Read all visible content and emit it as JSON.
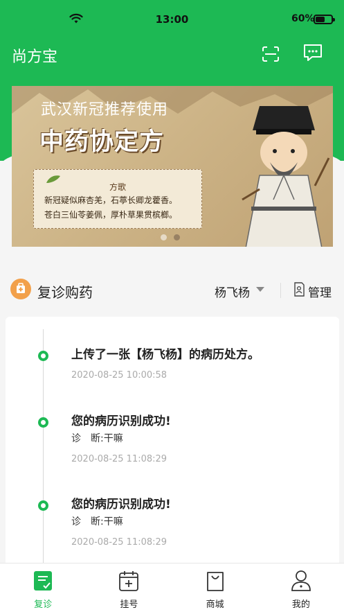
{
  "status_bar": {
    "time": "13:00",
    "battery_percent": "60%",
    "battery_level": 0.6
  },
  "header": {
    "app_title": "尚方宝",
    "icons": [
      "scan-icon",
      "message-icon"
    ]
  },
  "banner": {
    "line1": "武汉新冠推荐使用",
    "line2": "中药协定方",
    "poem_title": "方歌",
    "poem_line1": "新冠疑似麻杏羌，石葶长卿龙藿香。",
    "poem_line2": "苍白三仙苓姜佩，厚朴草果贯槟榔。",
    "slide_count": 2,
    "active_slide": 2
  },
  "section": {
    "title": "复诊购药",
    "person_name": "杨飞杨",
    "manage_label": "管理",
    "colors": {
      "accent": "#1db954",
      "section_icon": "#f2a04a"
    }
  },
  "timeline": [
    {
      "title": "上传了一张【杨飞杨】的病历处方。",
      "subtitle": "",
      "time": "2020-08-25 10:00:58"
    },
    {
      "title": "您的病历识别成功!",
      "subtitle": "诊　断:干嘛",
      "time": "2020-08-25 11:08:29"
    },
    {
      "title": "您的病历识别成功!",
      "subtitle": "诊　断:干嘛",
      "time": "2020-08-25 11:08:29"
    }
  ],
  "tabbar": [
    {
      "label": "复诊",
      "icon": "prescription-icon",
      "active": true
    },
    {
      "label": "挂号",
      "icon": "calendar-plus-icon",
      "active": false
    },
    {
      "label": "商城",
      "icon": "shopping-bag-icon",
      "active": false
    },
    {
      "label": "我的",
      "icon": "user-icon",
      "active": false
    }
  ]
}
